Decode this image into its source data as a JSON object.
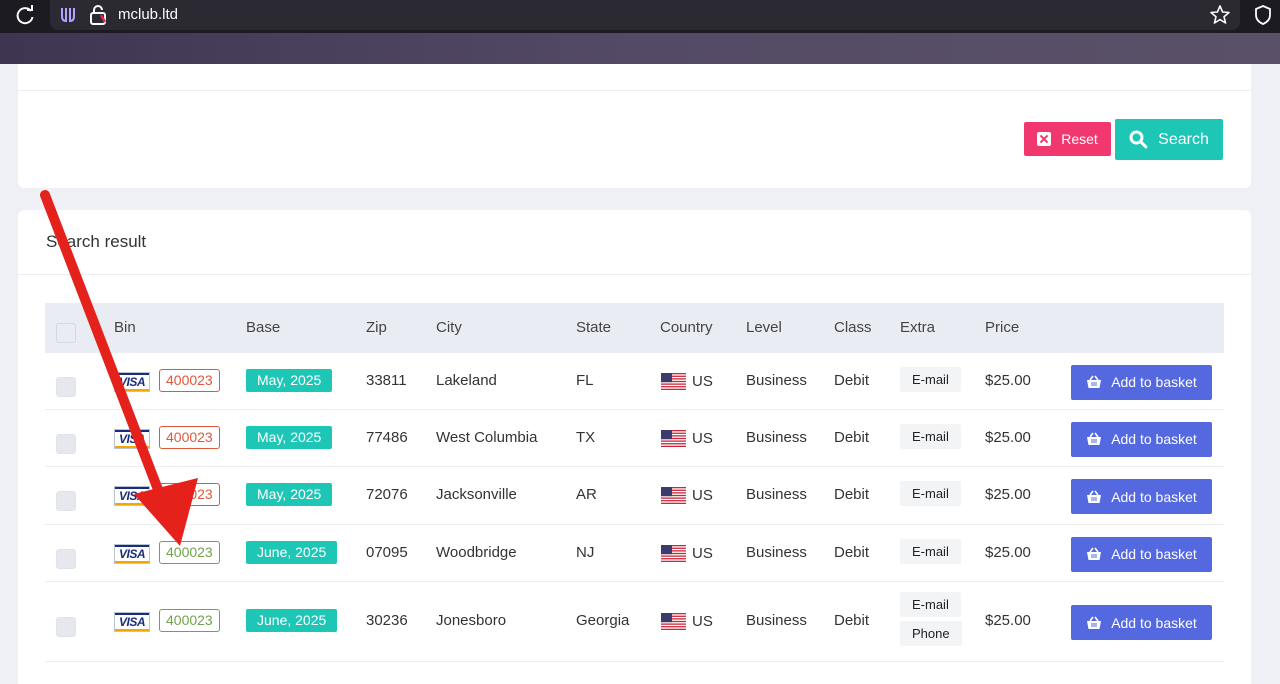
{
  "browser": {
    "url": "mclub.ltd"
  },
  "filter": {
    "reset_label": "Reset",
    "search_label": "Search"
  },
  "results": {
    "title": "Search result",
    "columns": [
      "Bin",
      "Base",
      "Zip",
      "City",
      "State",
      "Country",
      "Level",
      "Class",
      "Extra",
      "Price"
    ],
    "basket_label": "Add to basket",
    "rows": [
      {
        "card": "VISA",
        "bin": "400023",
        "bin_color": "#e1583c",
        "base": "May, 2025",
        "zip": "33811",
        "city": "Lakeland",
        "state": "FL",
        "country": "US",
        "level": "Business",
        "class": "Debit",
        "extra": [
          "E-mail"
        ],
        "price": "$25.00"
      },
      {
        "card": "VISA",
        "bin": "400023",
        "bin_color": "#e1583c",
        "base": "May, 2025",
        "zip": "77486",
        "city": "West Columbia",
        "state": "TX",
        "country": "US",
        "level": "Business",
        "class": "Debit",
        "extra": [
          "E-mail"
        ],
        "price": "$25.00"
      },
      {
        "card": "VISA",
        "bin": "400023",
        "bin_color": "#e1583c",
        "base": "May, 2025",
        "zip": "72076",
        "city": "Jacksonville",
        "state": "AR",
        "country": "US",
        "level": "Business",
        "class": "Debit",
        "extra": [
          "E-mail"
        ],
        "price": "$25.00"
      },
      {
        "card": "VISA",
        "bin": "400023",
        "bin_color": "#72a34c",
        "base": "June, 2025",
        "zip": "07095",
        "city": "Woodbridge",
        "state": "NJ",
        "country": "US",
        "level": "Business",
        "class": "Debit",
        "extra": [
          "E-mail"
        ],
        "price": "$25.00"
      },
      {
        "card": "VISA",
        "bin": "400023",
        "bin_color": "#72a34c",
        "base": "June, 2025",
        "zip": "30236",
        "city": "Jonesboro",
        "state": "Georgia",
        "country": "US",
        "level": "Business",
        "class": "Debit",
        "extra": [
          "E-mail",
          "Phone"
        ],
        "price": "$25.00"
      }
    ]
  },
  "icons": {
    "reload": "reload-icon",
    "tracker": "tracking-protection-icon",
    "lock": "lock-icon",
    "star": "bookmark-star-icon",
    "shield": "shield-icon",
    "reset": "close-box-icon",
    "search": "search-icon",
    "basket": "basket-icon",
    "flag": "us-flag-icon"
  },
  "colors": {
    "reset": "#f1386e",
    "search": "#1ec6b6",
    "basket": "#5468e0",
    "annotation_arrow": "#e4221b"
  }
}
